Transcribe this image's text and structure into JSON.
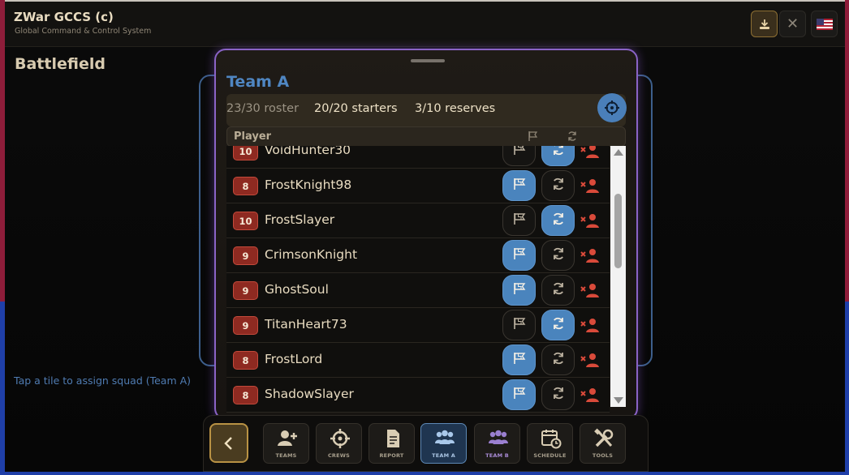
{
  "app": {
    "title": "ZWar GCCS (c)",
    "subtitle": "Global Command & Control System"
  },
  "topbar": {
    "download_icon": "download-icon",
    "close_glyph": "✕",
    "flag_icon": "us-flag-icon"
  },
  "battlefield": {
    "title": "Battlefield",
    "hint": "Tap a tile to assign squad (Team A)"
  },
  "modal": {
    "team_title": "Team A",
    "stats": {
      "roster": "23/30 roster",
      "starters": "20/20 starters",
      "reserves": "3/10 reserves"
    },
    "header": {
      "player": "Player",
      "flag_icon": "flag-icon",
      "swap_icon": "swap-icon"
    },
    "players": [
      {
        "level": "10",
        "name": "VoidHunter30",
        "starter": false,
        "reserve": true
      },
      {
        "level": "8",
        "name": "FrostKnight98",
        "starter": true,
        "reserve": false
      },
      {
        "level": "10",
        "name": "FrostSlayer",
        "starter": false,
        "reserve": true
      },
      {
        "level": "9",
        "name": "CrimsonKnight",
        "starter": true,
        "reserve": false
      },
      {
        "level": "9",
        "name": "GhostSoul",
        "starter": true,
        "reserve": false
      },
      {
        "level": "9",
        "name": "TitanHeart73",
        "starter": false,
        "reserve": true
      },
      {
        "level": "8",
        "name": "FrostLord",
        "starter": true,
        "reserve": false
      },
      {
        "level": "8",
        "name": "ShadowSlayer",
        "starter": true,
        "reserve": false
      }
    ]
  },
  "nav": {
    "items": [
      {
        "label": "TEAMS",
        "icon": "add-user-icon"
      },
      {
        "label": "CREWS",
        "icon": "crosshair-icon"
      },
      {
        "label": "REPORT",
        "icon": "document-icon"
      },
      {
        "label": "TEAM A",
        "icon": "group-icon",
        "active": true
      },
      {
        "label": "TEAM B",
        "icon": "group-icon"
      },
      {
        "label": "SCHEDULE",
        "icon": "calendar-clock-icon"
      },
      {
        "label": "TOOLS",
        "icon": "tools-icon"
      }
    ]
  },
  "colors": {
    "accent_blue": "#4a84bd",
    "level_badge": "#8e2a21",
    "modal_border": "#8a63c6",
    "gold": "#b99244"
  }
}
